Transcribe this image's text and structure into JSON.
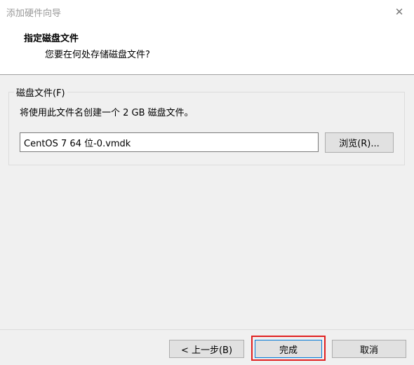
{
  "window": {
    "title": "添加硬件向导",
    "close_symbol": "✕"
  },
  "header": {
    "title": "指定磁盘文件",
    "subtitle": "您要在何处存储磁盘文件?"
  },
  "disk_file_group": {
    "legend": "磁盘文件(F)",
    "description": "将使用此文件名创建一个 2 GB 磁盘文件。",
    "file_name_value": "CentOS 7 64 位-0.vmdk",
    "browse_label": "浏览(R)..."
  },
  "footer": {
    "back_label": "< 上一步(B)",
    "finish_label": "完成",
    "cancel_label": "取消"
  },
  "colors": {
    "highlight_border": "#e02020",
    "default_button_border": "#0078d7"
  }
}
